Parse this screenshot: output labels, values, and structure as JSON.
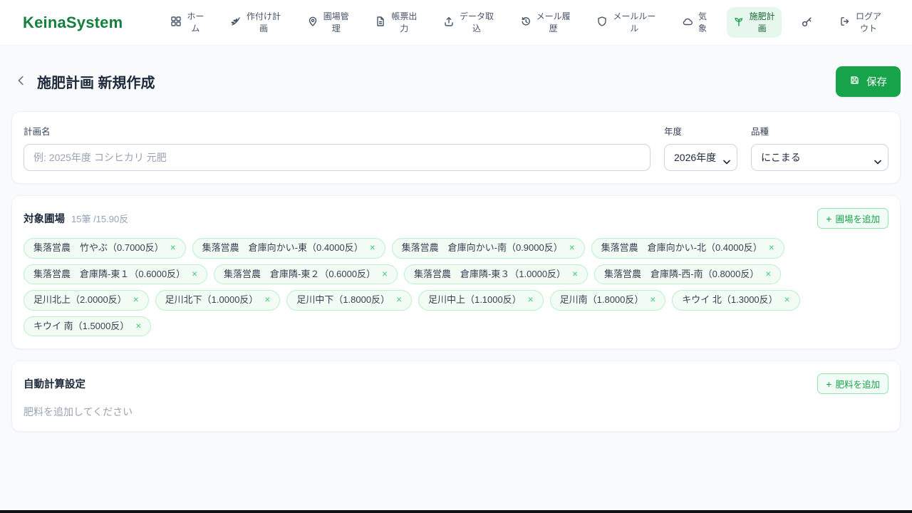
{
  "icons": {
    "close": "×",
    "plus": "+",
    "back": "‹"
  },
  "header": {
    "logo": "KeinaSystem",
    "nav": [
      {
        "label": "ホー\nム",
        "icon": "grid-icon"
      },
      {
        "label": "作付け計\n画",
        "icon": "wheat-icon"
      },
      {
        "label": "圃場管\n理",
        "icon": "map-pin-icon"
      },
      {
        "label": "帳票出\n力",
        "icon": "document-icon"
      },
      {
        "label": "データ取\n込",
        "icon": "upload-icon"
      },
      {
        "label": "メール履\n歴",
        "icon": "history-icon"
      },
      {
        "label": "メールルー\nル",
        "icon": "shield-icon"
      },
      {
        "label": "気\n象",
        "icon": "cloud-icon"
      },
      {
        "label": "施肥計\n画",
        "icon": "sprout-icon"
      },
      {
        "label": "",
        "icon": "key-icon"
      },
      {
        "label": "ログア\nウト",
        "icon": "logout-icon"
      }
    ]
  },
  "page": {
    "title": "施肥計画 新規作成",
    "save_label": "保存"
  },
  "form": {
    "plan_name": {
      "label": "計画名",
      "placeholder": "例: 2025年度 コシヒカリ 元肥",
      "value": ""
    },
    "year": {
      "label": "年度",
      "value": "2026年度"
    },
    "variety": {
      "label": "品種",
      "value": "にこまる"
    }
  },
  "fields": {
    "title": "対象圃場",
    "count": "15筆 /15.90反",
    "add_button": "圃場を追加",
    "tags": [
      {
        "text": "集落営農　竹やぶ（0.7000反）"
      },
      {
        "text": "集落営農　倉庫向かい-東（0.4000反）"
      },
      {
        "text": "集落営農　倉庫向かい-南（0.9000反）"
      },
      {
        "text": "集落営農　倉庫向かい-北（0.4000反）"
      },
      {
        "text": "集落営農　倉庫隣-東１（0.6000反）"
      },
      {
        "text": "集落営農　倉庫隣-東２（0.6000反）"
      },
      {
        "text": "集落営農　倉庫隣-東３（1.0000反）"
      },
      {
        "text": "集落営農　倉庫隣-西-南（0.8000反）"
      },
      {
        "text": "足川北上（2.0000反）"
      },
      {
        "text": "足川北下（1.0000反）"
      },
      {
        "text": "足川中下（1.8000反）"
      },
      {
        "text": "足川中上（1.1000反）"
      },
      {
        "text": "足川南（1.8000反）"
      },
      {
        "text": "キウイ 北（1.3000反）"
      },
      {
        "text": "キウイ 南（1.5000反）"
      }
    ]
  },
  "auto_calc": {
    "title": "自動計算設定",
    "add_button": "肥料を追加",
    "empty_text": "肥料を追加してください"
  }
}
